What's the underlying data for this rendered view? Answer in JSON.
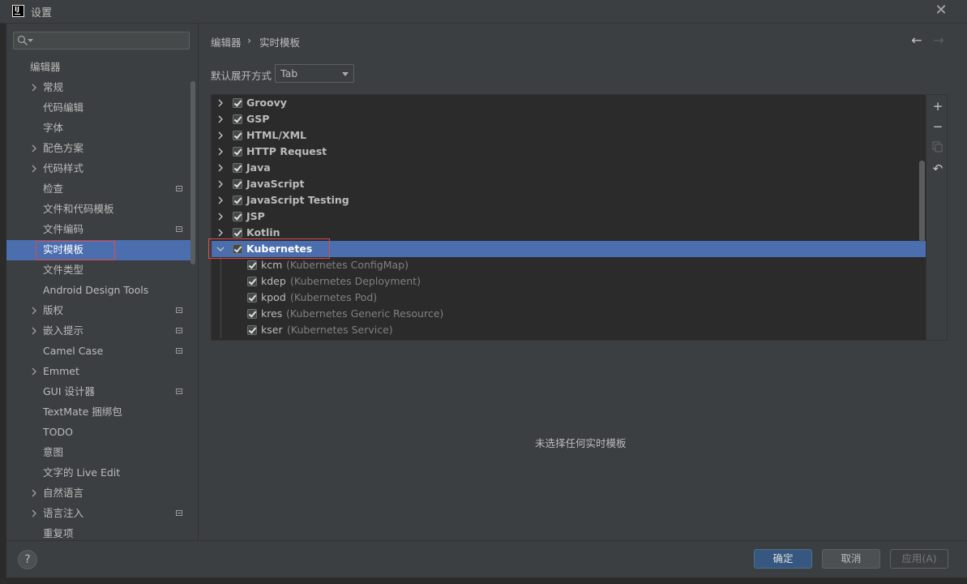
{
  "window": {
    "title": "设置",
    "logo_text": "IJ"
  },
  "search": {
    "placeholder": "",
    "value": ""
  },
  "sidebar": {
    "section": "编辑器",
    "items": [
      {
        "label": "常规",
        "expandable": true,
        "badge": false
      },
      {
        "label": "代码编辑",
        "expandable": false,
        "badge": false
      },
      {
        "label": "字体",
        "expandable": false,
        "badge": false
      },
      {
        "label": "配色方案",
        "expandable": true,
        "badge": false
      },
      {
        "label": "代码样式",
        "expandable": true,
        "badge": false
      },
      {
        "label": "检查",
        "expandable": false,
        "badge": true
      },
      {
        "label": "文件和代码模板",
        "expandable": false,
        "badge": false
      },
      {
        "label": "文件编码",
        "expandable": false,
        "badge": true
      },
      {
        "label": "实时模板",
        "expandable": false,
        "badge": false,
        "selected": true
      },
      {
        "label": "文件类型",
        "expandable": false,
        "badge": false
      },
      {
        "label": "Android Design Tools",
        "expandable": false,
        "badge": false
      },
      {
        "label": "版权",
        "expandable": true,
        "badge": true
      },
      {
        "label": "嵌入提示",
        "expandable": true,
        "badge": true
      },
      {
        "label": "Camel Case",
        "expandable": false,
        "badge": true
      },
      {
        "label": "Emmet",
        "expandable": true,
        "badge": false
      },
      {
        "label": "GUI 设计器",
        "expandable": false,
        "badge": true
      },
      {
        "label": "TextMate 捆绑包",
        "expandable": false,
        "badge": false
      },
      {
        "label": "TODO",
        "expandable": false,
        "badge": false
      },
      {
        "label": "意图",
        "expandable": false,
        "badge": false
      },
      {
        "label": "文字的 Live Edit",
        "expandable": false,
        "badge": false
      },
      {
        "label": "自然语言",
        "expandable": true,
        "badge": false
      },
      {
        "label": "语言注入",
        "expandable": true,
        "badge": true
      },
      {
        "label": "重复项",
        "expandable": false,
        "badge": false
      }
    ]
  },
  "breadcrumb": {
    "parent": "编辑器",
    "separator": "›",
    "current": "实时模板"
  },
  "nav": {
    "back": "←",
    "forward": "→"
  },
  "expand_setting": {
    "label": "默认展开方式",
    "value": "Tab"
  },
  "template_groups": [
    {
      "name": "Groovy",
      "checked": true,
      "expanded": false
    },
    {
      "name": "GSP",
      "checked": true,
      "expanded": false
    },
    {
      "name": "HTML/XML",
      "checked": true,
      "expanded": false
    },
    {
      "name": "HTTP Request",
      "checked": true,
      "expanded": false
    },
    {
      "name": "Java",
      "checked": true,
      "expanded": false
    },
    {
      "name": "JavaScript",
      "checked": true,
      "expanded": false
    },
    {
      "name": "JavaScript Testing",
      "checked": true,
      "expanded": false
    },
    {
      "name": "JSP",
      "checked": true,
      "expanded": false
    },
    {
      "name": "Kotlin",
      "checked": true,
      "expanded": false
    },
    {
      "name": "Kubernetes",
      "checked": true,
      "expanded": true,
      "selected": true
    }
  ],
  "kubernetes_templates": [
    {
      "key": "kcm",
      "desc": "(Kubernetes ConfigMap)",
      "checked": true
    },
    {
      "key": "kdep",
      "desc": "(Kubernetes Deployment)",
      "checked": true
    },
    {
      "key": "kpod",
      "desc": "(Kubernetes Pod)",
      "checked": true
    },
    {
      "key": "kres",
      "desc": "(Kubernetes Generic Resource)",
      "checked": true
    },
    {
      "key": "kser",
      "desc": "(Kubernetes Service)",
      "checked": true
    }
  ],
  "toolbar": {
    "add": "+",
    "remove": "−",
    "copy": "copy-icon",
    "restore": "↶"
  },
  "empty_message": "未选择任何实时模板",
  "buttons": {
    "help": "?",
    "ok": "确定",
    "cancel": "取消",
    "apply": "应用(A)"
  },
  "colors": {
    "selection": "#4b6eaf",
    "highlight_box": "#e0494b",
    "background": "#3c3f41"
  }
}
